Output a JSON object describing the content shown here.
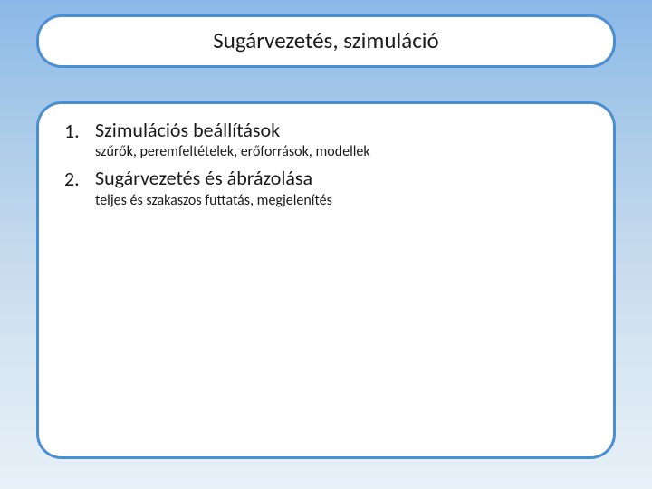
{
  "title": "Sugárvezetés, szimuláció",
  "items": [
    {
      "heading": "Szimulációs beállítások",
      "sub": "szűrők, peremfeltételek, erőforrások, modellek"
    },
    {
      "heading": "Sugárvezetés és ábrázolása",
      "sub": "teljes és szakaszos futtatás, megjelenítés"
    }
  ]
}
